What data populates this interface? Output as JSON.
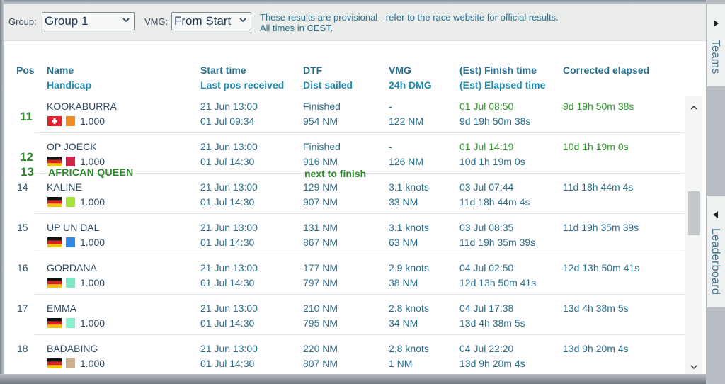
{
  "toolbar": {
    "group_label": "Group:",
    "group_value": "Group 1",
    "vmg_label": "VMG:",
    "vmg_value": "From Start",
    "note_line1": "These results are provisional - refer to the race website for official results.",
    "note_line2": "All times in CEST."
  },
  "columns": {
    "pos": "Pos",
    "name": "Name",
    "handicap": "Handicap",
    "start_time": "Start time",
    "last_pos": "Last pos received",
    "dtf": "DTF",
    "dist_sailed": "Dist sailed",
    "vmg": "VMG",
    "dmg": "24h DMG",
    "finish": "(Est) Finish time",
    "elapsed": "(Est) Elapsed time",
    "corrected": "Corrected elapsed"
  },
  "rows": [
    {
      "pos": "11",
      "name": "KOOKABURRA",
      "handicap": "1.000",
      "start": "21 Jun 13:00",
      "last": "01 Jul 09:34",
      "dtf": "Finished",
      "dist": "954 NM",
      "vmg": "-",
      "dmg": "122 NM",
      "finish": "01 Jul 08:50",
      "elapsed": "9d 19h 50m 38s",
      "corrected": "9d 19h 50m 38s",
      "flag": "ch",
      "color": "#f08a24"
    },
    {
      "pos": "12",
      "name": "OP JOECK",
      "handicap": "1.000",
      "start": "21 Jun 13:00",
      "last": "01 Jul 14:30",
      "dtf": "Finished",
      "dist": "916 NM",
      "vmg": "-",
      "dmg": "126 NM",
      "finish": "01 Jul 14:19",
      "elapsed": "10d 1h 19m 0s",
      "corrected": "10d 1h 19m 0s",
      "flag": "de",
      "color": "#d2234a"
    },
    {
      "pos": "14",
      "name": "KALINE",
      "handicap": "1.000",
      "start": "21 Jun 13:00",
      "last": "01 Jul 14:30",
      "dtf": "129 NM",
      "dist": "907 NM",
      "vmg": "3.1 knots",
      "dmg": "33 NM",
      "finish": "03 Jul 07:44",
      "elapsed": "11d 18h 44m 4s",
      "corrected": "11d 18h 44m 4s",
      "flag": "de",
      "color": "#a6e33a"
    },
    {
      "pos": "15",
      "name": "UP UN DAL",
      "handicap": "1.000",
      "start": "21 Jun 13:00",
      "last": "01 Jul 14:30",
      "dtf": "131 NM",
      "dist": "867 NM",
      "vmg": "3.1 knots",
      "dmg": "63 NM",
      "finish": "03 Jul 08:35",
      "elapsed": "11d 19h 35m 39s",
      "corrected": "11d 19h 35m 39s",
      "flag": "de",
      "color": "#3088e6"
    },
    {
      "pos": "16",
      "name": "GORDANA",
      "handicap": "1.000",
      "start": "21 Jun 13:00",
      "last": "01 Jul 14:30",
      "dtf": "177 NM",
      "dist": "797 NM",
      "vmg": "2.9 knots",
      "dmg": "38 NM",
      "finish": "04 Jul 02:50",
      "elapsed": "12d 13h 50m 41s",
      "corrected": "12d 13h 50m 41s",
      "flag": "de",
      "color": "#7fe8c4"
    },
    {
      "pos": "17",
      "name": "EMMA",
      "handicap": "1.000",
      "start": "21 Jun 13:00",
      "last": "01 Jul 14:30",
      "dtf": "210 NM",
      "dist": "795 NM",
      "vmg": "2.8 knots",
      "dmg": "34 NM",
      "finish": "04 Jul 17:38",
      "elapsed": "13d 4h 38m 5s",
      "corrected": "13d 4h 38m 5s",
      "flag": "de",
      "color": "#88f0c8"
    },
    {
      "pos": "18",
      "name": "BADABING",
      "handicap": "1.000",
      "start": "21 Jun 13:00",
      "last": "01 Jul 14:30",
      "dtf": "220 NM",
      "dist": "807 NM",
      "vmg": "2.8 knots",
      "dmg": "1 NM",
      "finish": "04 Jul 22:20",
      "elapsed": "13d 9h 20m 4s",
      "corrected": "13d 9h 20m 4s",
      "flag": "de",
      "color": "#cdb08c"
    }
  ],
  "annotations": {
    "pos_13": "13",
    "boat_13": "AFRICAN QUEEN",
    "next": "next to finish"
  },
  "side_tabs": {
    "teams": "Teams",
    "leaderboard": "Leaderboard"
  },
  "colors": {
    "accent": "#2a6f8c",
    "finished_green": "#2e9a2a"
  }
}
